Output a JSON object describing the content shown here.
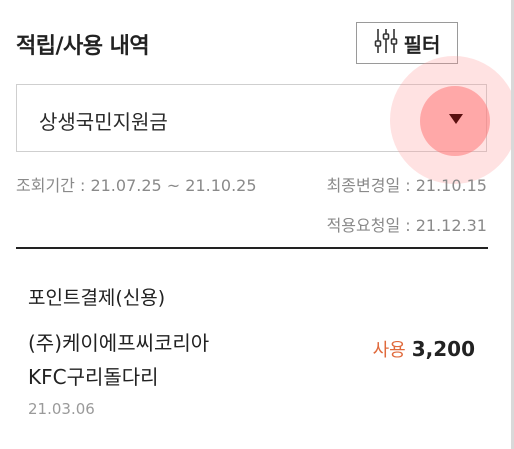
{
  "header": {
    "title": "적립/사용 내역",
    "filter_label": "필터",
    "filter_icon": "sliders-icon"
  },
  "dropdown": {
    "selected": "상생국민지원금",
    "icon": "caret-down-icon"
  },
  "meta": {
    "period": "조회기간 : 21.07.25 ~ 21.10.25",
    "last_changed": "최종변경일 : 21.10.15",
    "applied": "적용요청일 : 21.12.31"
  },
  "transactions": [
    {
      "type": "포인트결제(신용)",
      "merchant_line1": "(주)케이에프씨코리아",
      "merchant_line2": "KFC구리돌다리",
      "usage_label": "사용",
      "amount": "3,200",
      "date": "21.03.06"
    }
  ],
  "colors": {
    "usage_accent": "#e06a3c",
    "touch_highlight": "#ff8a8a"
  }
}
